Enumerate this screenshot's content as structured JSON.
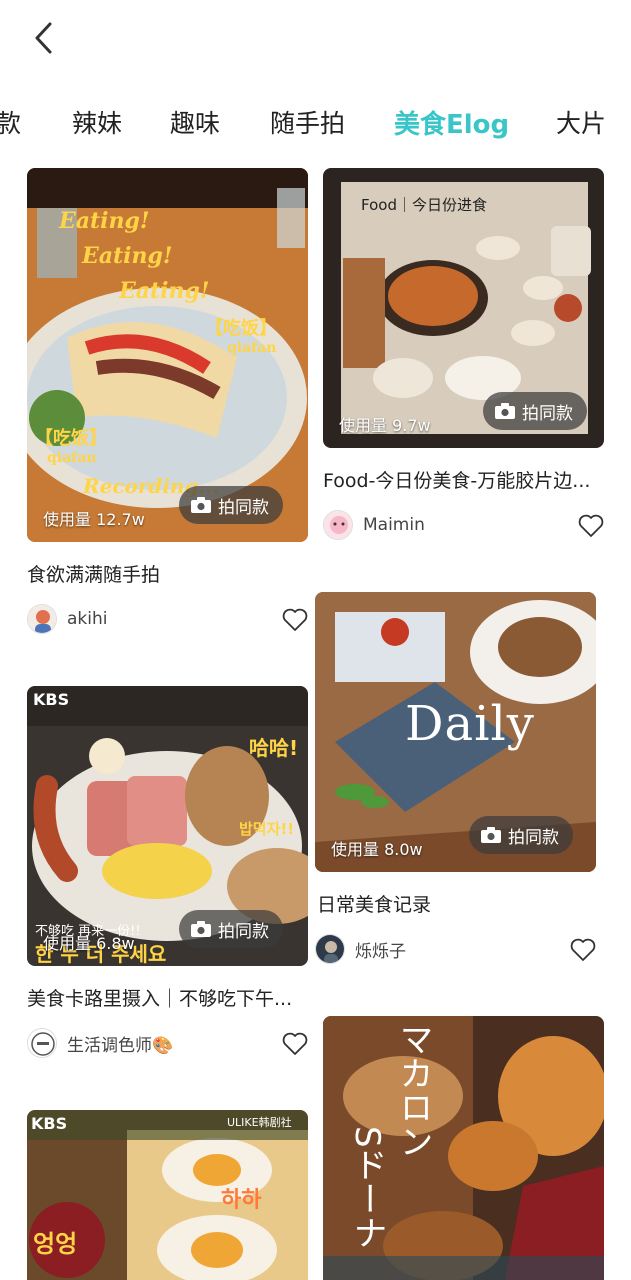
{
  "nav": {
    "back_icon": "chevron-left-icon"
  },
  "tabs": [
    {
      "label": "款"
    },
    {
      "label": "辣妹"
    },
    {
      "label": "趣味"
    },
    {
      "label": "随手拍"
    },
    {
      "label": "美食Elog",
      "active": true
    },
    {
      "label": "大片"
    }
  ],
  "accent_color": "#3ac6c9",
  "same_style_label": "拍同款",
  "cards": [
    {
      "usage": "使用量 12.7w",
      "title": "食欲满满随手拍",
      "author": "akihi",
      "overlay": [
        "Eating!",
        "Eating!",
        "Eating!",
        "【吃饭】",
        "qiafan",
        "【吃饭】",
        "qiafan",
        "Recording..."
      ]
    },
    {
      "usage": "使用量 9.7w",
      "title": "Food-今日份美食-万能胶片边...",
      "author": "Maimin",
      "overlay": [
        "Food｜今日份进食"
      ]
    },
    {
      "usage": "使用量 6.8w",
      "title": "美食卡路里摄入｜不够吃下午...",
      "author": "生活调色师🎨",
      "overlay": [
        "KBS",
        "哈哈!",
        "밥먹자!!",
        "不够吃 再来一份!!",
        "한 누 더 주세요"
      ]
    },
    {
      "usage": "使用量 8.0w",
      "title": "日常美食记录",
      "author": "烁烁子",
      "overlay": [
        "Daily"
      ]
    },
    {
      "usage": "",
      "title": "",
      "author": "",
      "overlay": [
        "KBS",
        "ULIKE韩剧社",
        "하하",
        "엉엉"
      ]
    },
    {
      "usage": "",
      "title": "",
      "author": "",
      "overlay": [
        "マカロン",
        "Sドーナ"
      ]
    }
  ]
}
